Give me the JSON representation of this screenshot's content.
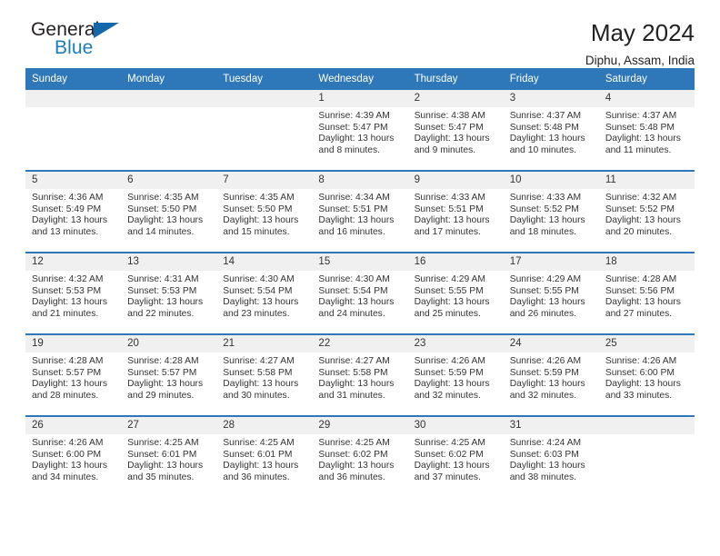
{
  "logo": {
    "word_one": "General",
    "word_two": "Blue",
    "triangle_icon": "blue-triangle-icon",
    "color_dark": "#231f20",
    "color_blue": "#1c7cc0"
  },
  "header": {
    "title": "May 2024",
    "subtitle": "Diphu, Assam, India"
  },
  "theme": {
    "header_blue": "#2e77b8",
    "daynum_gray": "#f0f0f0",
    "text": "#333333"
  },
  "weekdays": [
    "Sunday",
    "Monday",
    "Tuesday",
    "Wednesday",
    "Thursday",
    "Friday",
    "Saturday"
  ],
  "weeks": [
    {
      "days": [
        {
          "date": "",
          "sunrise": "",
          "sunset": "",
          "daylight_line1": "",
          "daylight_line2": "",
          "empty": true
        },
        {
          "date": "",
          "sunrise": "",
          "sunset": "",
          "daylight_line1": "",
          "daylight_line2": "",
          "empty": true
        },
        {
          "date": "",
          "sunrise": "",
          "sunset": "",
          "daylight_line1": "",
          "daylight_line2": "",
          "empty": true
        },
        {
          "date": "1",
          "sunrise": "Sunrise: 4:39 AM",
          "sunset": "Sunset: 5:47 PM",
          "daylight_line1": "Daylight: 13 hours",
          "daylight_line2": "and 8 minutes.",
          "empty": false
        },
        {
          "date": "2",
          "sunrise": "Sunrise: 4:38 AM",
          "sunset": "Sunset: 5:47 PM",
          "daylight_line1": "Daylight: 13 hours",
          "daylight_line2": "and 9 minutes.",
          "empty": false
        },
        {
          "date": "3",
          "sunrise": "Sunrise: 4:37 AM",
          "sunset": "Sunset: 5:48 PM",
          "daylight_line1": "Daylight: 13 hours",
          "daylight_line2": "and 10 minutes.",
          "empty": false
        },
        {
          "date": "4",
          "sunrise": "Sunrise: 4:37 AM",
          "sunset": "Sunset: 5:48 PM",
          "daylight_line1": "Daylight: 13 hours",
          "daylight_line2": "and 11 minutes.",
          "empty": false
        }
      ]
    },
    {
      "days": [
        {
          "date": "5",
          "sunrise": "Sunrise: 4:36 AM",
          "sunset": "Sunset: 5:49 PM",
          "daylight_line1": "Daylight: 13 hours",
          "daylight_line2": "and 13 minutes.",
          "empty": false
        },
        {
          "date": "6",
          "sunrise": "Sunrise: 4:35 AM",
          "sunset": "Sunset: 5:50 PM",
          "daylight_line1": "Daylight: 13 hours",
          "daylight_line2": "and 14 minutes.",
          "empty": false
        },
        {
          "date": "7",
          "sunrise": "Sunrise: 4:35 AM",
          "sunset": "Sunset: 5:50 PM",
          "daylight_line1": "Daylight: 13 hours",
          "daylight_line2": "and 15 minutes.",
          "empty": false
        },
        {
          "date": "8",
          "sunrise": "Sunrise: 4:34 AM",
          "sunset": "Sunset: 5:51 PM",
          "daylight_line1": "Daylight: 13 hours",
          "daylight_line2": "and 16 minutes.",
          "empty": false
        },
        {
          "date": "9",
          "sunrise": "Sunrise: 4:33 AM",
          "sunset": "Sunset: 5:51 PM",
          "daylight_line1": "Daylight: 13 hours",
          "daylight_line2": "and 17 minutes.",
          "empty": false
        },
        {
          "date": "10",
          "sunrise": "Sunrise: 4:33 AM",
          "sunset": "Sunset: 5:52 PM",
          "daylight_line1": "Daylight: 13 hours",
          "daylight_line2": "and 18 minutes.",
          "empty": false
        },
        {
          "date": "11",
          "sunrise": "Sunrise: 4:32 AM",
          "sunset": "Sunset: 5:52 PM",
          "daylight_line1": "Daylight: 13 hours",
          "daylight_line2": "and 20 minutes.",
          "empty": false
        }
      ]
    },
    {
      "days": [
        {
          "date": "12",
          "sunrise": "Sunrise: 4:32 AM",
          "sunset": "Sunset: 5:53 PM",
          "daylight_line1": "Daylight: 13 hours",
          "daylight_line2": "and 21 minutes.",
          "empty": false
        },
        {
          "date": "13",
          "sunrise": "Sunrise: 4:31 AM",
          "sunset": "Sunset: 5:53 PM",
          "daylight_line1": "Daylight: 13 hours",
          "daylight_line2": "and 22 minutes.",
          "empty": false
        },
        {
          "date": "14",
          "sunrise": "Sunrise: 4:30 AM",
          "sunset": "Sunset: 5:54 PM",
          "daylight_line1": "Daylight: 13 hours",
          "daylight_line2": "and 23 minutes.",
          "empty": false
        },
        {
          "date": "15",
          "sunrise": "Sunrise: 4:30 AM",
          "sunset": "Sunset: 5:54 PM",
          "daylight_line1": "Daylight: 13 hours",
          "daylight_line2": "and 24 minutes.",
          "empty": false
        },
        {
          "date": "16",
          "sunrise": "Sunrise: 4:29 AM",
          "sunset": "Sunset: 5:55 PM",
          "daylight_line1": "Daylight: 13 hours",
          "daylight_line2": "and 25 minutes.",
          "empty": false
        },
        {
          "date": "17",
          "sunrise": "Sunrise: 4:29 AM",
          "sunset": "Sunset: 5:55 PM",
          "daylight_line1": "Daylight: 13 hours",
          "daylight_line2": "and 26 minutes.",
          "empty": false
        },
        {
          "date": "18",
          "sunrise": "Sunrise: 4:28 AM",
          "sunset": "Sunset: 5:56 PM",
          "daylight_line1": "Daylight: 13 hours",
          "daylight_line2": "and 27 minutes.",
          "empty": false
        }
      ]
    },
    {
      "days": [
        {
          "date": "19",
          "sunrise": "Sunrise: 4:28 AM",
          "sunset": "Sunset: 5:57 PM",
          "daylight_line1": "Daylight: 13 hours",
          "daylight_line2": "and 28 minutes.",
          "empty": false
        },
        {
          "date": "20",
          "sunrise": "Sunrise: 4:28 AM",
          "sunset": "Sunset: 5:57 PM",
          "daylight_line1": "Daylight: 13 hours",
          "daylight_line2": "and 29 minutes.",
          "empty": false
        },
        {
          "date": "21",
          "sunrise": "Sunrise: 4:27 AM",
          "sunset": "Sunset: 5:58 PM",
          "daylight_line1": "Daylight: 13 hours",
          "daylight_line2": "and 30 minutes.",
          "empty": false
        },
        {
          "date": "22",
          "sunrise": "Sunrise: 4:27 AM",
          "sunset": "Sunset: 5:58 PM",
          "daylight_line1": "Daylight: 13 hours",
          "daylight_line2": "and 31 minutes.",
          "empty": false
        },
        {
          "date": "23",
          "sunrise": "Sunrise: 4:26 AM",
          "sunset": "Sunset: 5:59 PM",
          "daylight_line1": "Daylight: 13 hours",
          "daylight_line2": "and 32 minutes.",
          "empty": false
        },
        {
          "date": "24",
          "sunrise": "Sunrise: 4:26 AM",
          "sunset": "Sunset: 5:59 PM",
          "daylight_line1": "Daylight: 13 hours",
          "daylight_line2": "and 32 minutes.",
          "empty": false
        },
        {
          "date": "25",
          "sunrise": "Sunrise: 4:26 AM",
          "sunset": "Sunset: 6:00 PM",
          "daylight_line1": "Daylight: 13 hours",
          "daylight_line2": "and 33 minutes.",
          "empty": false
        }
      ]
    },
    {
      "days": [
        {
          "date": "26",
          "sunrise": "Sunrise: 4:26 AM",
          "sunset": "Sunset: 6:00 PM",
          "daylight_line1": "Daylight: 13 hours",
          "daylight_line2": "and 34 minutes.",
          "empty": false
        },
        {
          "date": "27",
          "sunrise": "Sunrise: 4:25 AM",
          "sunset": "Sunset: 6:01 PM",
          "daylight_line1": "Daylight: 13 hours",
          "daylight_line2": "and 35 minutes.",
          "empty": false
        },
        {
          "date": "28",
          "sunrise": "Sunrise: 4:25 AM",
          "sunset": "Sunset: 6:01 PM",
          "daylight_line1": "Daylight: 13 hours",
          "daylight_line2": "and 36 minutes.",
          "empty": false
        },
        {
          "date": "29",
          "sunrise": "Sunrise: 4:25 AM",
          "sunset": "Sunset: 6:02 PM",
          "daylight_line1": "Daylight: 13 hours",
          "daylight_line2": "and 36 minutes.",
          "empty": false
        },
        {
          "date": "30",
          "sunrise": "Sunrise: 4:25 AM",
          "sunset": "Sunset: 6:02 PM",
          "daylight_line1": "Daylight: 13 hours",
          "daylight_line2": "and 37 minutes.",
          "empty": false
        },
        {
          "date": "31",
          "sunrise": "Sunrise: 4:24 AM",
          "sunset": "Sunset: 6:03 PM",
          "daylight_line1": "Daylight: 13 hours",
          "daylight_line2": "and 38 minutes.",
          "empty": false
        },
        {
          "date": "",
          "sunrise": "",
          "sunset": "",
          "daylight_line1": "",
          "daylight_line2": "",
          "empty": true
        }
      ]
    }
  ]
}
